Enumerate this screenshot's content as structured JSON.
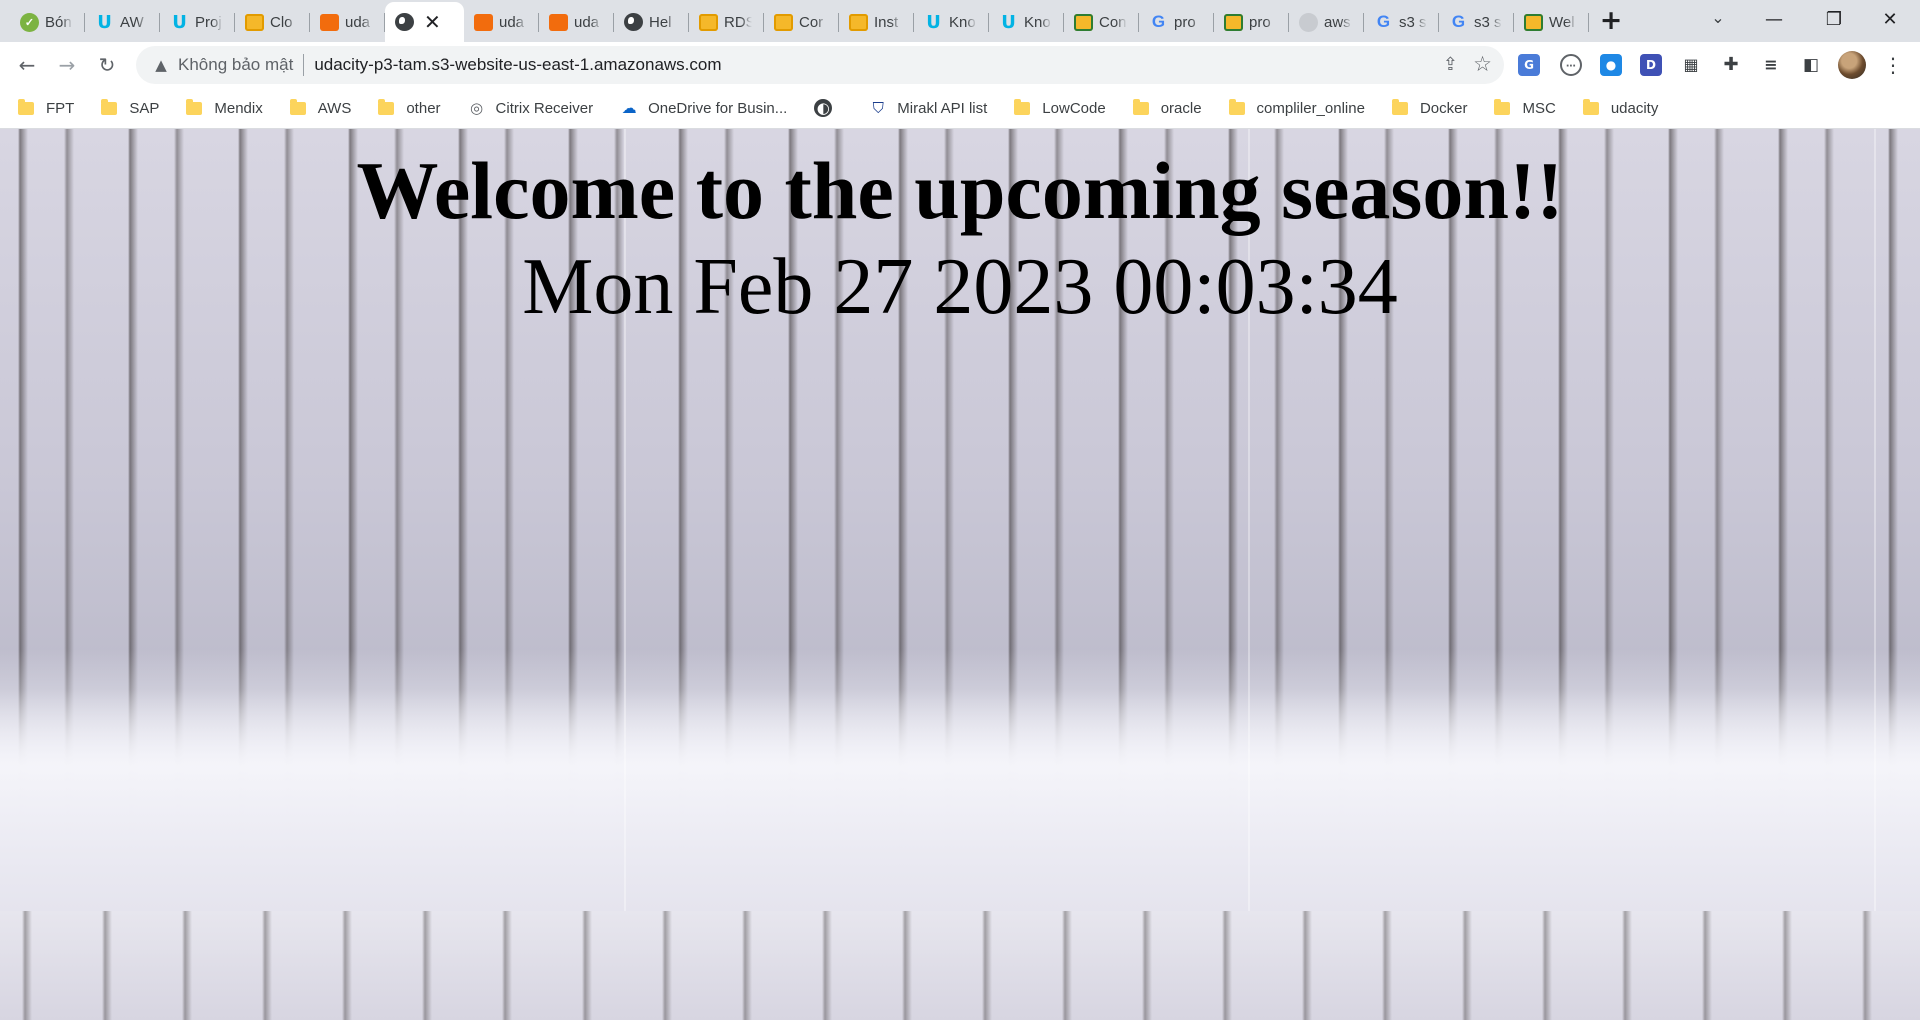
{
  "tabs": [
    {
      "label": "Bón",
      "icon": "check-icon",
      "active": false
    },
    {
      "label": "AW",
      "icon": "udacity-icon",
      "active": false
    },
    {
      "label": "Proj",
      "icon": "udacity-icon",
      "active": false
    },
    {
      "label": "Clo",
      "icon": "box-icon",
      "active": false
    },
    {
      "label": "uda",
      "icon": "aws-icon",
      "active": false
    },
    {
      "label": "",
      "icon": "globe-icon",
      "active": true
    },
    {
      "label": "uda",
      "icon": "aws-icon",
      "active": false
    },
    {
      "label": "uda",
      "icon": "aws-icon",
      "active": false
    },
    {
      "label": "Hel",
      "icon": "globe-icon",
      "active": false
    },
    {
      "label": "RDS",
      "icon": "box-icon",
      "active": false
    },
    {
      "label": "Cor",
      "icon": "box-icon",
      "active": false
    },
    {
      "label": "Inst",
      "icon": "box-icon",
      "active": false
    },
    {
      "label": "Kno",
      "icon": "udacity-icon",
      "active": false
    },
    {
      "label": "Kno",
      "icon": "udacity-icon",
      "active": false
    },
    {
      "label": "Con",
      "icon": "s3-icon",
      "active": false
    },
    {
      "label": "pro",
      "icon": "google-icon",
      "active": false
    },
    {
      "label": "pro",
      "icon": "s3-icon",
      "active": false
    },
    {
      "label": "aws",
      "icon": "github-icon",
      "active": false
    },
    {
      "label": "s3 s",
      "icon": "google-icon",
      "active": false
    },
    {
      "label": "s3 s",
      "icon": "google-icon",
      "active": false
    },
    {
      "label": "Wel",
      "icon": "s3-icon",
      "active": false
    }
  ],
  "address_bar": {
    "security_text": "Không bảo mật",
    "url": "udacity-p3-tam.s3-website-us-east-1.amazonaws.com"
  },
  "bookmarks": [
    {
      "label": "FPT",
      "icon": "folder-icon"
    },
    {
      "label": "SAP",
      "icon": "folder-icon"
    },
    {
      "label": "Mendix",
      "icon": "folder-icon"
    },
    {
      "label": "AWS",
      "icon": "folder-icon"
    },
    {
      "label": "other",
      "icon": "folder-icon"
    },
    {
      "label": "Citrix Receiver",
      "icon": "citrix-icon"
    },
    {
      "label": "OneDrive for Busin...",
      "icon": "onedrive-icon"
    },
    {
      "label": "",
      "icon": "globe-icon"
    },
    {
      "label": "Mirakl API list",
      "icon": "shield-icon"
    },
    {
      "label": "LowCode",
      "icon": "folder-icon"
    },
    {
      "label": "oracle",
      "icon": "folder-icon"
    },
    {
      "label": "compliler_online",
      "icon": "folder-icon"
    },
    {
      "label": "Docker",
      "icon": "folder-icon"
    },
    {
      "label": "MSC",
      "icon": "folder-icon"
    },
    {
      "label": "udacity",
      "icon": "folder-icon"
    }
  ],
  "page": {
    "heading": "Welcome to the upcoming season!!",
    "datetime": "Mon Feb 27 2023 00:03:34"
  }
}
